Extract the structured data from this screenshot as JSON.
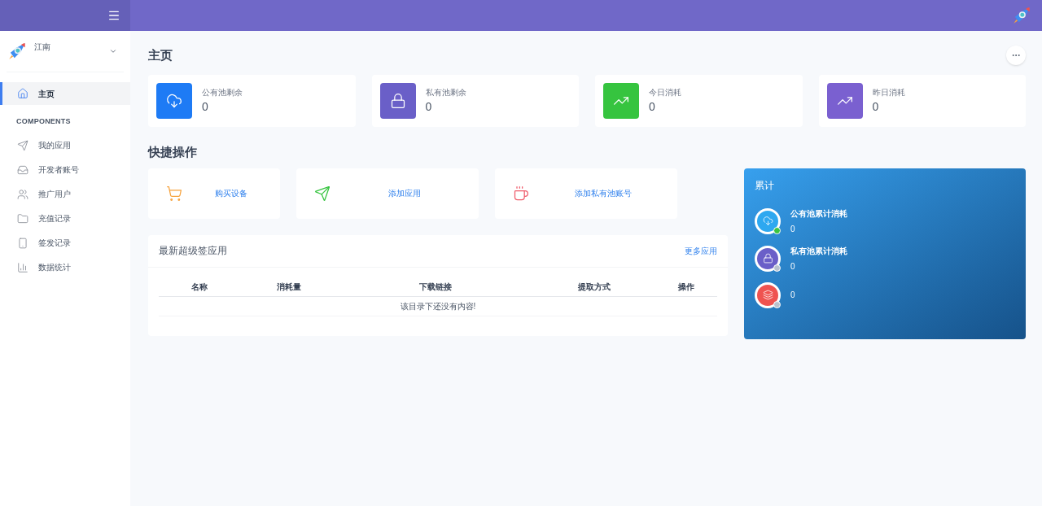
{
  "sidebar": {
    "user": "江南",
    "section": "COMPONENTS",
    "items": [
      {
        "label": "主页",
        "selected": true
      },
      {
        "label": "我的应用",
        "selected": false
      },
      {
        "label": "开发者账号",
        "selected": false
      },
      {
        "label": "推广用户",
        "selected": false
      },
      {
        "label": "充值记录",
        "selected": false
      },
      {
        "label": "签发记录",
        "selected": false
      },
      {
        "label": "数据统计",
        "selected": false
      }
    ]
  },
  "page_title": "主页",
  "stats": [
    {
      "label": "公有池剩余",
      "value": "0",
      "color": "#1e7bf5"
    },
    {
      "label": "私有池剩余",
      "value": "0",
      "color": "#6a5fc8"
    },
    {
      "label": "今日消耗",
      "value": "0",
      "color": "#36c43f"
    },
    {
      "label": "昨日消耗",
      "value": "0",
      "color": "#7a60d0"
    }
  ],
  "quick_title": "快捷操作",
  "quick_actions": [
    {
      "label": "购买设备"
    },
    {
      "label": "添加应用"
    },
    {
      "label": "添加私有池账号"
    }
  ],
  "apps_panel": {
    "title": "最新超级签应用",
    "more_link": "更多应用",
    "columns": [
      "名称",
      "消耗量",
      "下载链接",
      "提取方式",
      "操作"
    ],
    "empty_message": "该目录下还没有内容!"
  },
  "totals": {
    "title": "累计",
    "items": [
      {
        "label": "公有池累计消耗",
        "value": "0",
        "color": "#3ac43f"
      },
      {
        "label": "私有池累计消耗",
        "value": "0",
        "color": "#b9c3cf"
      },
      {
        "value": "0",
        "color": "#b9c3cf"
      }
    ]
  }
}
